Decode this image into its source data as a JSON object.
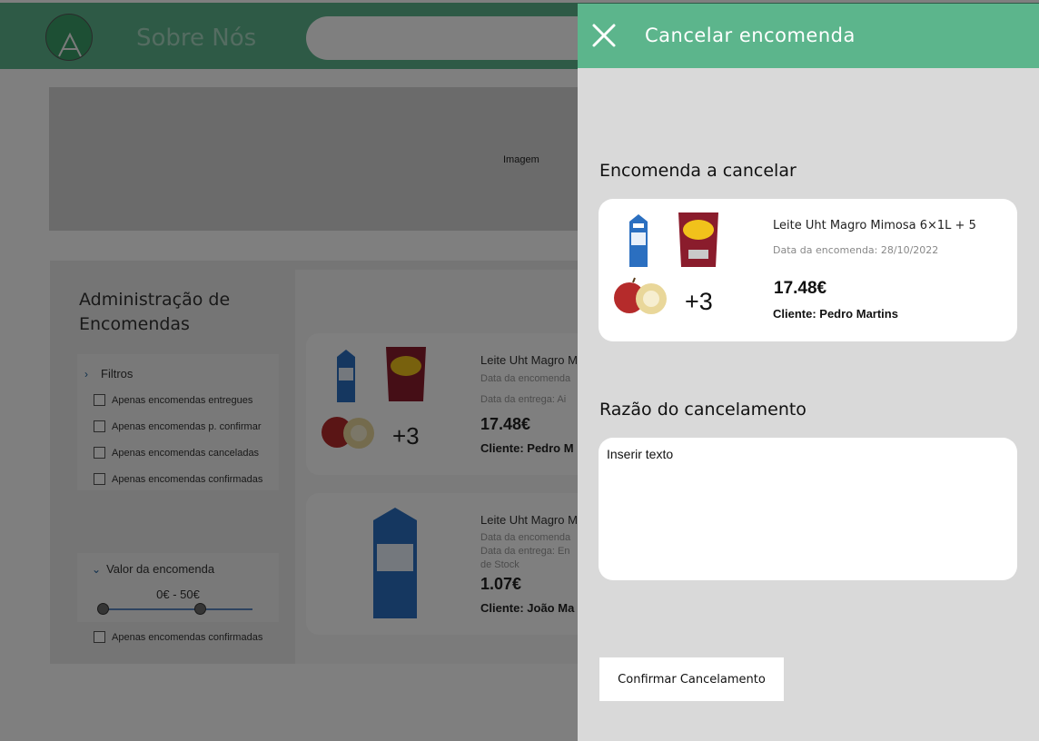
{
  "header": {
    "nav_title": "Sobre Nós"
  },
  "hero": {
    "label": "Imagem"
  },
  "admin": {
    "title": "Administração de Encomendas",
    "filters": {
      "label": "Filtros",
      "items": [
        "Apenas encomendas entregues",
        "Apenas encomendas p. confirmar",
        "Apenas encomendas canceladas",
        "Apenas encomendas confirmadas"
      ]
    },
    "valor": {
      "label": "Valor da encomenda",
      "range": "0€ - 50€",
      "slider_min_fraction": 0.0,
      "slider_max_fraction": 0.65,
      "extra": "Apenas encomendas confirmadas"
    },
    "orders": [
      {
        "name": "Leite Uht Magro M",
        "order_date": "Data da encomenda",
        "delivery": "Data da entrega: Ai",
        "price": "17.48€",
        "client": "Cliente: Pedro M",
        "more": "+3"
      },
      {
        "name": "Leite Uht Magro M",
        "order_date": "Data da encomenda",
        "delivery": "Data da entrega: En",
        "delivery2": "de Stock",
        "price": "1.07€",
        "client": "Cliente: João Ma"
      }
    ]
  },
  "drawer": {
    "title": "Cancelar encomenda",
    "order_section_title": "Encomenda a cancelar",
    "order": {
      "name": "Leite Uht Magro Mimosa 6×1L + 5",
      "date": "Data da encomenda: 28/10/2022",
      "price": "17.48€",
      "client": "Cliente: Pedro Martins",
      "more": "+3"
    },
    "reason_section_title": "Razão do cancelamento",
    "reason_placeholder": "Inserir texto",
    "confirm_label": "Confirmar Cancelamento"
  },
  "colors": {
    "brand_green": "#5cb58c",
    "drawer_bg": "#d9d9d9",
    "overlay": "rgba(0,0,0,0.5)"
  },
  "icons": {
    "close": "close-icon",
    "milk": "milk-carton-icon",
    "chips": "chips-bag-icon",
    "apples": "apples-icon"
  }
}
